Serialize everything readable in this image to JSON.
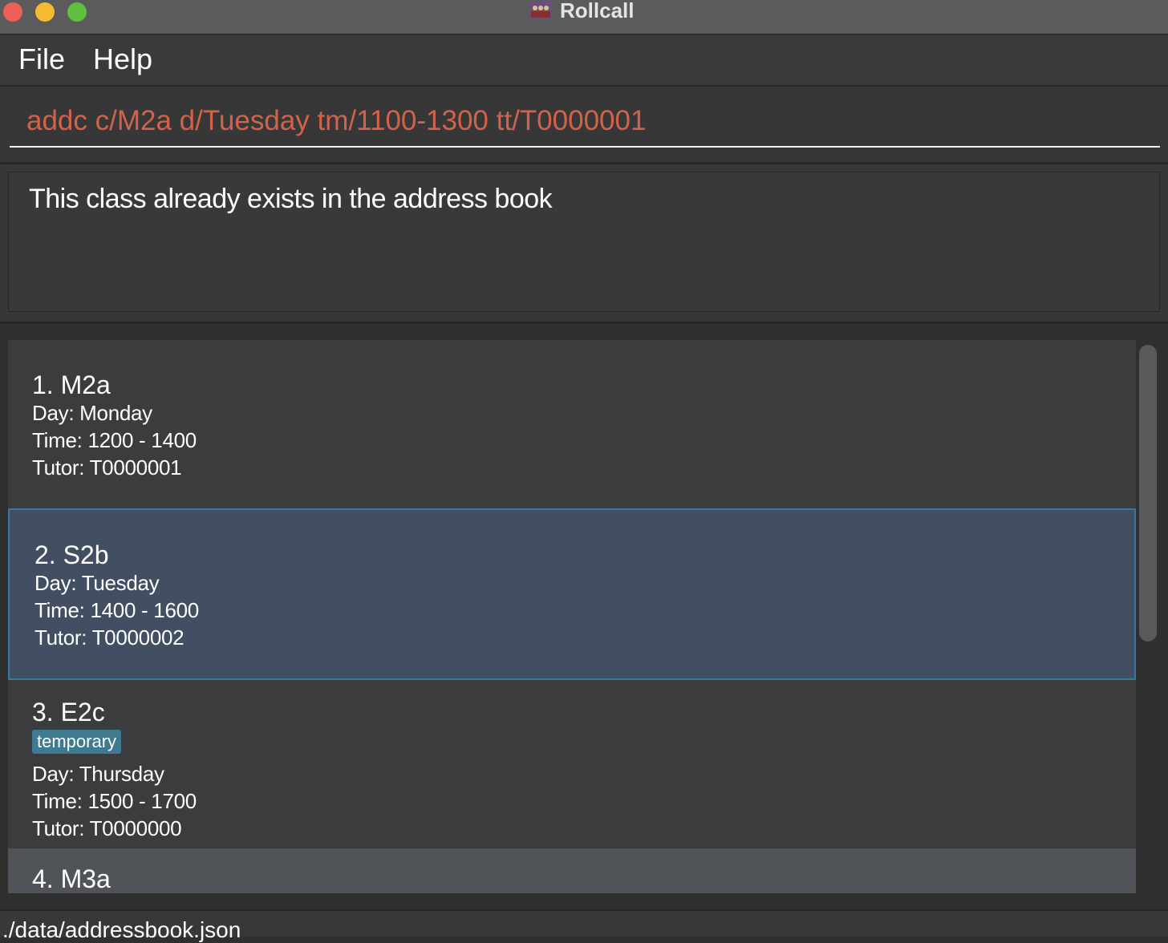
{
  "window": {
    "title": "Rollcall",
    "icon": "app-logo-icon"
  },
  "menu": {
    "file_label": "File",
    "help_label": "Help"
  },
  "command": {
    "value": "addc c/M2a d/Tuesday tm/1100-1300 tt/T0000001"
  },
  "result": {
    "message": "This class already exists in the address book"
  },
  "classes": [
    {
      "title": "1. M2a",
      "day": "Day: Monday",
      "time": "Time: 1200 - 1400",
      "tutor": "Tutor: T0000001"
    },
    {
      "title": "2. S2b",
      "day": "Day: Tuesday",
      "time": "Time: 1400 - 1600",
      "tutor": "Tutor: T0000002"
    },
    {
      "title": "3. E2c",
      "tag": "temporary",
      "day": "Day: Thursday",
      "time": "Time: 1500 - 1700",
      "tutor": "Tutor: T0000000"
    },
    {
      "title": "4. M3a"
    }
  ],
  "status": {
    "path": "./data/addressbook.json"
  },
  "colors": {
    "command_text": "#d2634a",
    "selected_card": "#424f62",
    "selected_border": "#3678a0",
    "tag_bg": "#3e7b91"
  }
}
